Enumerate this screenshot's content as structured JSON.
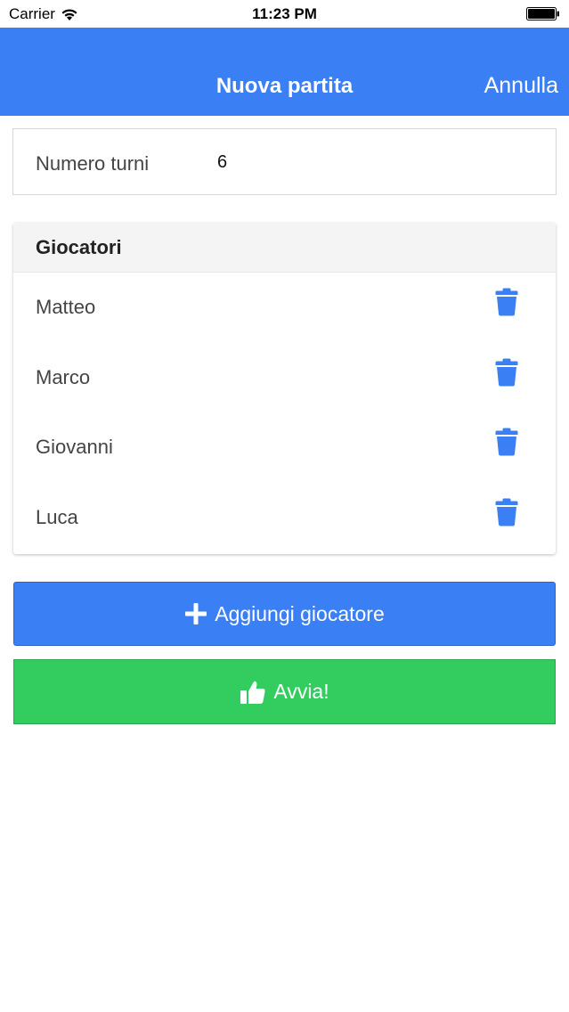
{
  "status_bar": {
    "carrier": "Carrier",
    "time": "11:23 PM"
  },
  "navbar": {
    "title": "Nuova partita",
    "cancel_label": "Annulla",
    "background": "#3b7ff5"
  },
  "rounds": {
    "label": "Numero turni",
    "value": "6"
  },
  "players": {
    "header": "Giocatori",
    "items": [
      {
        "name": "Matteo"
      },
      {
        "name": "Marco"
      },
      {
        "name": "Giovanni"
      },
      {
        "name": "Luca"
      }
    ],
    "delete_icon": "trash-icon",
    "icon_color": "#3b7ff5"
  },
  "actions": {
    "add_label": "Aggiungi giocatore",
    "add_icon": "plus-icon",
    "add_color": "#3b7ff5",
    "start_label": "Avvia!",
    "start_icon": "thumbs-up-icon",
    "start_color": "#33cd5f"
  }
}
